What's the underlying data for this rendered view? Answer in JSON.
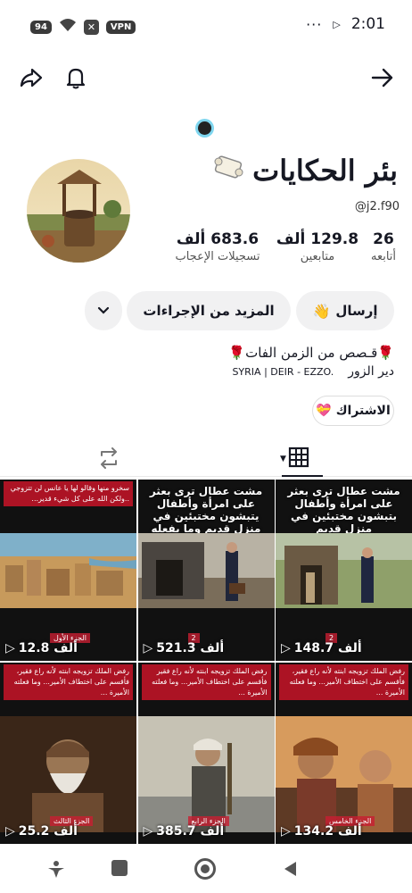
{
  "status_bar": {
    "battery": "94",
    "vpn": "VPN",
    "time": "2:01",
    "more": "···"
  },
  "profile": {
    "name": "بئر الحكايات",
    "handle": "@j2.f90",
    "stats": [
      {
        "value": "26",
        "label": "أتابعه"
      },
      {
        "value": "129.8 ألف",
        "label": "متابعين"
      },
      {
        "value": "683.6 ألف",
        "label": "تسجيلات الإعجاب"
      }
    ],
    "buttons": {
      "send": "إرسال",
      "more_actions": "المزيد من الإجراءات"
    },
    "bio_line1": "قـصص من الزمن الفات",
    "bio_line2_left": "SYRIA | DEIR - EZZO.",
    "bio_line2_right": "دير الزور",
    "subscribe": "الاشتراك"
  },
  "videos": [
    {
      "views": "148.7 ألف",
      "caption": "مشت عطال ترى بعثر على امرأة وأطفال بتبشون مختبئين في منزل قديم",
      "caption_type": "big",
      "tag": "2",
      "colors": [
        "#6b5a44",
        "#3b3a35",
        "#8fa06a"
      ]
    },
    {
      "views": "521.3 ألف",
      "caption": "مشت عطال ترى بعثر على امرأة وأطفال يتبشون مختبئين في منزل قديم وما يفعله بعدها",
      "caption_type": "big",
      "tag": "2",
      "colors": [
        "#7a6d5a",
        "#4a4540",
        "#b8b2a4"
      ]
    },
    {
      "views": "12.8 ألف",
      "caption": "سخرو منها وقالو لها يا عانس لن تتزوجي ..ولكن الله على كل شيء قدير...",
      "caption_type": "small",
      "tag": "الجزء الأول",
      "colors": [
        "#c79a5c",
        "#a27848",
        "#7fb0c9"
      ]
    },
    {
      "views": "134.2 ألف",
      "caption": "رفض الملك تزويجه ابنته لأنه راع فقير، فأقسم على اختطاف الأمير... وما فعلته الأميرة ...",
      "caption_type": "small",
      "tag": "الجزء الخامس",
      "colors": [
        "#a0623a",
        "#5e3a25",
        "#d79b5d"
      ]
    },
    {
      "views": "385.7 ألف",
      "caption": "رفض الملك تزويجه ابنته لأنه راع فقير فأقسم على اختطاف الأمير... وما فعلته الأميرة ...",
      "caption_type": "small",
      "tag": "الجزء الرابع",
      "colors": [
        "#8a8a84",
        "#4c4a44",
        "#c6c2b4"
      ]
    },
    {
      "views": "25.2 ألف",
      "caption": "رفض الملك تزويجه ابنته لأنه راع فقير، فأقسم على اختطاف الأمير... وما فعلته الأميرة ...",
      "caption_type": "small",
      "tag": "الجزء الثالث",
      "colors": [
        "#6c4a30",
        "#3a2618",
        "#9a7654"
      ]
    }
  ]
}
